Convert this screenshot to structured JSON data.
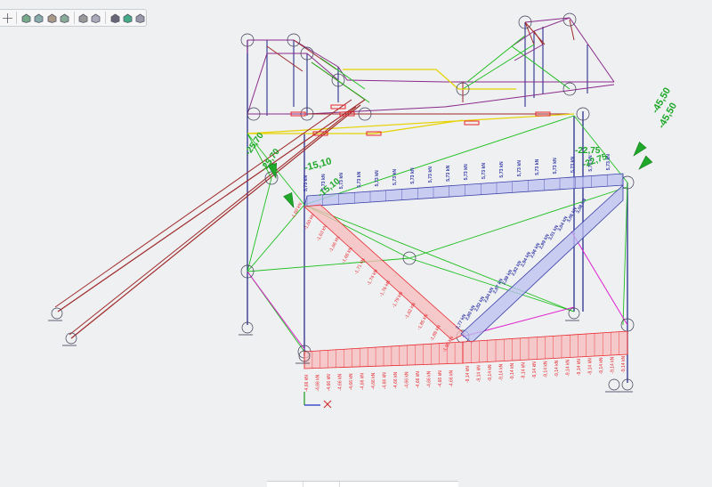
{
  "toolbar": {
    "buttons": [
      {
        "icon": "move-axes-icon"
      },
      {
        "icon": "view-iso-icon"
      },
      {
        "icon": "view-top-icon"
      },
      {
        "icon": "view-front-icon"
      },
      {
        "icon": "view-side-icon"
      },
      {
        "icon": "wireframe-icon"
      },
      {
        "icon": "render-icon"
      },
      {
        "icon": "display-options-icon"
      },
      {
        "icon": "color-scheme-icon"
      },
      {
        "icon": "window-icon"
      }
    ]
  },
  "colors": {
    "background": "#eef0f2",
    "member_blue": "#2b2f8c",
    "member_purple": "#8a2a8a",
    "member_red": "#a02a2a",
    "member_green": "#1fbf1f",
    "member_yellow": "#e6d200",
    "member_magenta": "#e020d0",
    "load_red": "#e8262b",
    "load_red_fill": "#f7bcbc",
    "load_blue": "#3a3fa8",
    "load_blue_fill": "#bcc0f0",
    "reaction_green": "#1fa82a"
  },
  "reactions": {
    "left_top_a": "-15,10",
    "left_top_b": "-15,10",
    "left_diag_a": "-25,70",
    "left_diag_b": "-25,70",
    "right_a": "-45,50",
    "right_b": "-45,50",
    "right_c": "-22,75",
    "right_d": "-22,75"
  },
  "loads": {
    "top_beam": "5,73 kN",
    "left_diagonal": [
      "-1,60 kN",
      "-1,60 kN",
      "-1,63 kN",
      "-1,66 kN",
      "-1,68 kN",
      "-1,71 kN",
      "-1,74 kN",
      "-1,76 kN",
      "-1,79 kN",
      "-1,82 kN",
      "-1,85 kN",
      "-1,88 kN",
      "-1,90 kN"
    ],
    "right_diagonal": [
      "3,08 kN",
      "3,06 kN",
      "3,04 kN",
      "3,01 kN",
      "2,99 kN",
      "2,96 kN",
      "2,94 kN",
      "2,92 kN",
      "2,89 kN",
      "2,87 kN",
      "2,84 kN",
      "2,82 kN",
      "2,80 kN",
      "2,77 kN"
    ],
    "bottom_left": "-4,66 kN",
    "bottom_right": "-9,14 kN"
  },
  "status_bar": {
    "tabs": [
      "",
      ""
    ]
  }
}
